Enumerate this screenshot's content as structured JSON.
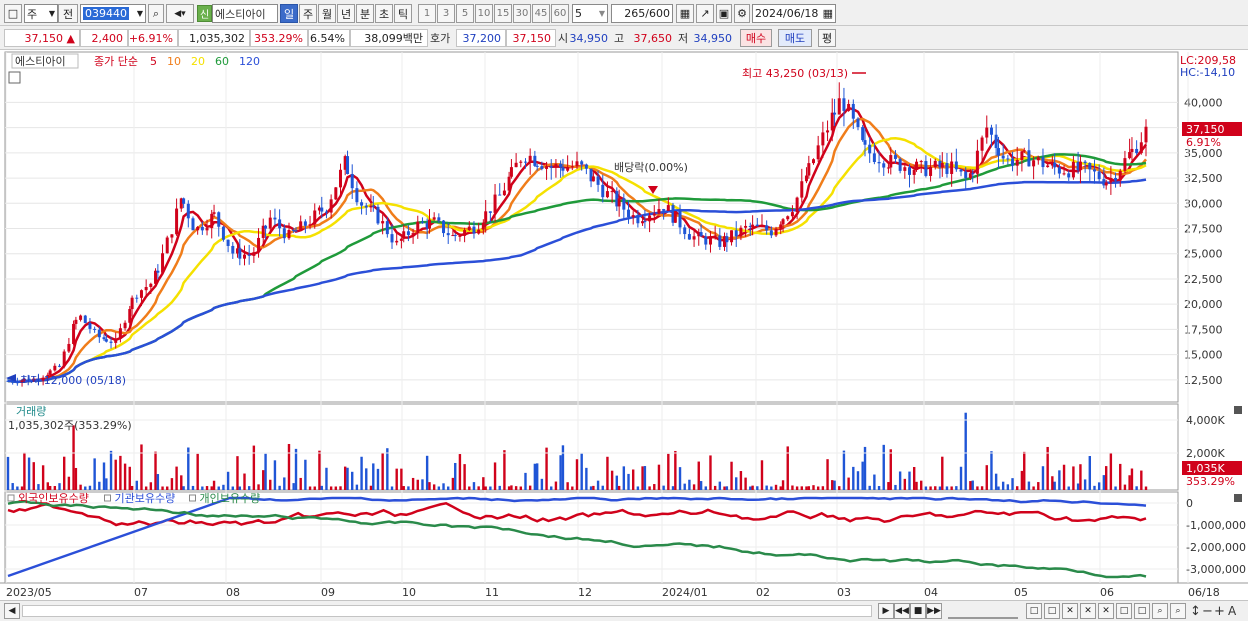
{
  "toolbar": {
    "period": "주",
    "prev": "전",
    "code": "039440",
    "credit_tag": "신",
    "name": "에스티아이",
    "tabs": [
      "일",
      "주",
      "월",
      "년",
      "분",
      "초",
      "틱"
    ],
    "selected_tab": "일",
    "intervals": [
      "1",
      "3",
      "5",
      "10",
      "15",
      "30",
      "45",
      "60"
    ],
    "interval_value": "5",
    "count": "265",
    "count_max": "/600",
    "date": "2024/06/18"
  },
  "quote": {
    "price": "37,150",
    "change": "2,400",
    "rate": "+6.91%",
    "volume": "1,035,302",
    "vol_ratio": "353.29%",
    "turnover": "6.54%",
    "amount": "38,099백만",
    "ask_label": "호가",
    "ask1": "37,200",
    "bid1": "37,150",
    "open_label": "시",
    "open": "34,950",
    "high_label": "고",
    "high": "37,650",
    "low_label": "저",
    "low": "34,950",
    "buy_label": "매수",
    "sell_label": "매도",
    "eval_label": "평"
  },
  "legend": {
    "stock_name": "에스티아이",
    "ma_label": "종가 단순",
    "ma_periods": [
      "5",
      "10",
      "20",
      "60",
      "120"
    ],
    "ma_colors": [
      "#d0021b",
      "#f07d1a",
      "#f5e100",
      "#1f9a3a",
      "#2b4fd8"
    ],
    "lc": "LC:209,58",
    "hc": "HC:-14,10"
  },
  "annotations": {
    "high": "최고 43,250 (03/13)",
    "low": "최저 12,000 (05/18)",
    "dividend": "배당락(0.00%)",
    "last_price": "37,150",
    "last_rate": "6.91%"
  },
  "volume_panel": {
    "title": "거래량",
    "value": "1,035,302주(353.29%)",
    "last": "1,035K",
    "last_rate": "353.29%",
    "ticks": [
      "4,000K",
      "2,000K"
    ]
  },
  "holdings_panel": {
    "series": [
      "외국인보유수량",
      "기관보유수량",
      "개인보유수량"
    ],
    "colors": [
      "#d0021b",
      "#2b4fd8",
      "#2a8a4a"
    ],
    "ticks": [
      "0",
      "-1,000,000",
      "-2,000,000",
      "-3,000,000"
    ]
  },
  "chart_data": {
    "type": "candlestick",
    "price_ticks": [
      "40,000",
      "37,500",
      "35,000",
      "32,500",
      "30,000",
      "27,500",
      "25,000",
      "22,500",
      "20,000",
      "17,500",
      "15,000",
      "12,500"
    ],
    "x_labels": [
      "2023/05",
      "07",
      "08",
      "09",
      "10",
      "11",
      "12",
      "2024/01",
      "02",
      "03",
      "04",
      "05",
      "06",
      "06/18"
    ],
    "close_path": [
      [
        0,
        12400
      ],
      [
        12,
        12600
      ],
      [
        22,
        13800
      ],
      [
        30,
        19000
      ],
      [
        38,
        16800
      ],
      [
        46,
        16200
      ],
      [
        54,
        21000
      ],
      [
        62,
        22200
      ],
      [
        70,
        27500
      ],
      [
        74,
        30500
      ],
      [
        80,
        27300
      ],
      [
        88,
        28800
      ],
      [
        96,
        25100
      ],
      [
        104,
        24800
      ],
      [
        112,
        28500
      ],
      [
        120,
        26700
      ],
      [
        128,
        28100
      ],
      [
        136,
        29700
      ],
      [
        144,
        34000
      ],
      [
        150,
        30200
      ],
      [
        158,
        28600
      ],
      [
        166,
        25900
      ],
      [
        174,
        27800
      ],
      [
        182,
        28100
      ],
      [
        190,
        26700
      ],
      [
        200,
        27800
      ],
      [
        210,
        30700
      ],
      [
        220,
        35000
      ],
      [
        232,
        33600
      ],
      [
        244,
        33700
      ],
      [
        256,
        30900
      ],
      [
        268,
        28500
      ],
      [
        280,
        29800
      ],
      [
        292,
        26700
      ],
      [
        304,
        26100
      ],
      [
        316,
        27600
      ],
      [
        326,
        27300
      ],
      [
        336,
        30000
      ],
      [
        346,
        35500
      ],
      [
        356,
        40500
      ],
      [
        366,
        35200
      ],
      [
        378,
        34000
      ],
      [
        390,
        33400
      ],
      [
        402,
        33600
      ],
      [
        410,
        32200
      ],
      [
        418,
        37500
      ],
      [
        426,
        34200
      ],
      [
        436,
        34500
      ],
      [
        448,
        33400
      ],
      [
        460,
        33300
      ],
      [
        470,
        32200
      ],
      [
        478,
        34500
      ],
      [
        486,
        37150
      ]
    ],
    "last_close": 37150
  },
  "status_bar": {
    "icons": [
      "scroll-left",
      "play",
      "rewind",
      "stop",
      "fast-forward",
      "zoom-out",
      "zoom-in",
      "text"
    ]
  }
}
